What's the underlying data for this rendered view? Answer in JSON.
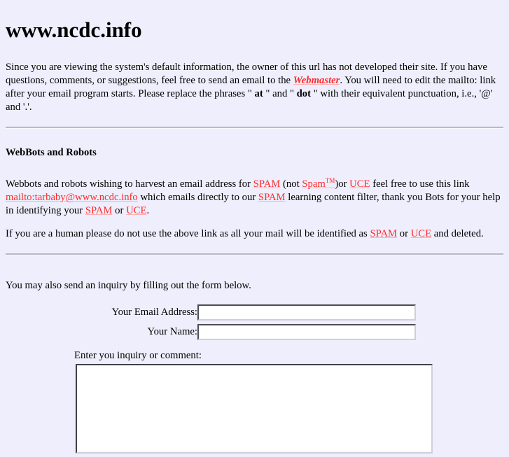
{
  "page": {
    "title": "www.ncdc.info",
    "background_color": "#eeeefc",
    "link_color": "#ff2b2b"
  },
  "intro": {
    "part1": "Since you are viewing the system's default information, the owner of this url has not developed their site.  If you have questions, comments, or suggestions, feel free to send an email to the ",
    "webmaster_link": "Webmaster",
    "part2": ".  You will need to edit the mailto: link after your email program starts.  Please replace the phrases \" ",
    "at_word": "at",
    "part3": " \" and \" ",
    "dot_word": "dot",
    "part4": " \" with their equivalent punctuation, i.e., '@' and '.'."
  },
  "webbots": {
    "heading": "WebBots and Robots",
    "p1_part1": "Webbots and robots wishing to harvest an email address for ",
    "p1_spam1": "SPAM",
    "p1_part2": " (not ",
    "p1_spam_tm": "Spam",
    "p1_tm": "TM",
    "p1_part3": ")or ",
    "p1_uce1": "UCE",
    "p1_part4": " feel free to use this link ",
    "mailto_link": "mailto:tarbaby@www.ncdc.info",
    "p1_part5": " which emails directly to our ",
    "p1_spam2": "SPAM",
    "p1_part6": " learning content filter, thank you Bots for your help in identifying your ",
    "p1_spam3": "SPAM",
    "p1_part7": " or ",
    "p1_uce2": "UCE",
    "p1_part8": ".",
    "p2_part1": "If you are a human please do not use the above link as all your mail will be identified as ",
    "p2_spam": "SPAM",
    "p2_part2": " or ",
    "p2_uce": "UCE",
    "p2_part3": " and deleted."
  },
  "form": {
    "intro": "You may also send an inquiry by filling out the form below.",
    "email_label": "Your Email Address:",
    "email_value": "",
    "email_placeholder": "",
    "name_label": "Your Name:",
    "name_value": "",
    "name_placeholder": "",
    "comment_label": "Enter you inquiry or comment:",
    "comment_value": "",
    "comment_placeholder": ""
  }
}
